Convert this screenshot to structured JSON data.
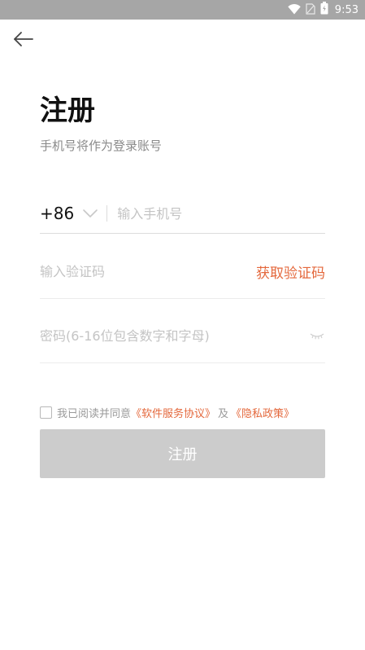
{
  "status_bar": {
    "time": "9:53",
    "icons": [
      "wifi-icon",
      "sim-card-icon",
      "battery-icon"
    ],
    "background": "#a6a6a6"
  },
  "header": {
    "back_icon": "arrow-left-icon",
    "title": "注册",
    "subtitle": "手机号将作为登录账号"
  },
  "form": {
    "country_code": "+86",
    "phone_placeholder": "输入手机号",
    "code_placeholder": "输入验证码",
    "get_code_label": "获取验证码",
    "password_placeholder": "密码(6-16位包含数字和字母)",
    "password_visibility_icon": "eye-closed-icon"
  },
  "agreement": {
    "prefix": "我已阅读并同意",
    "service_link": "《软件服务协议》",
    "conjunction": "及",
    "privacy_link": "《隐私政策》",
    "checked": false
  },
  "submit": {
    "label": "注册",
    "enabled": false
  },
  "colors": {
    "accent": "#e4683c",
    "button_disabled": "#cccccc",
    "placeholder": "#c4c4c4",
    "title": "#111111"
  }
}
